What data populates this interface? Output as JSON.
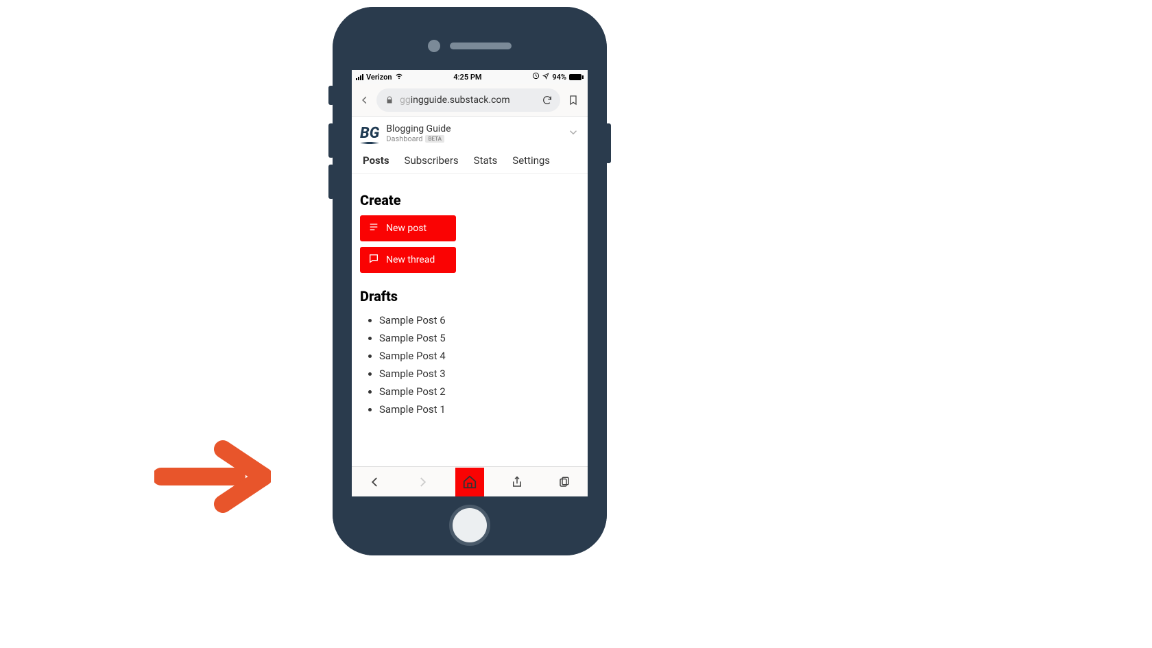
{
  "statusbar": {
    "carrier": "Verizon",
    "time": "4:25 PM",
    "battery_pct": "94%"
  },
  "browser": {
    "url_faded": "gg",
    "url_main": "ingguide.substack.com"
  },
  "site": {
    "logo_text": "BG",
    "title": "Blogging Guide",
    "dashboard_label": "Dashboard",
    "beta_label": "BETA"
  },
  "tabs": {
    "posts": "Posts",
    "subscribers": "Subscribers",
    "stats": "Stats",
    "settings": "Settings"
  },
  "create": {
    "heading": "Create",
    "new_post": "New post",
    "new_thread": "New thread"
  },
  "drafts": {
    "heading": "Drafts",
    "items": [
      "Sample Post 6",
      "Sample Post 5",
      "Sample Post 4",
      "Sample Post 3",
      "Sample Post 2",
      "Sample Post 1"
    ]
  }
}
